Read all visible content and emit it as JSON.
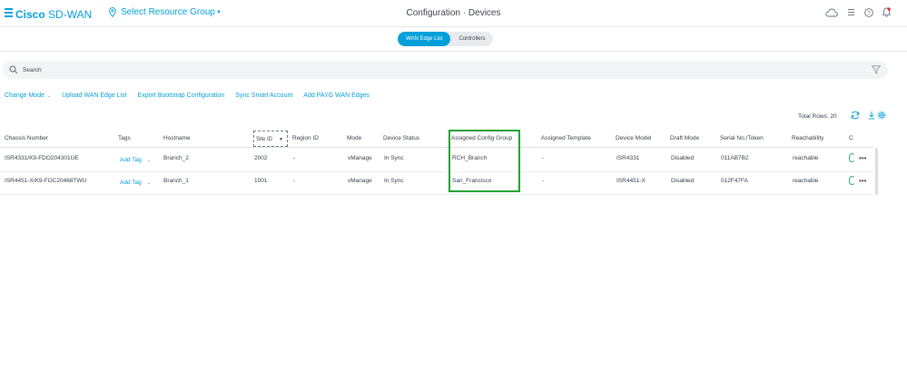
{
  "header": {
    "brand_bold": "Cisco",
    "brand_rest": "SD-WAN",
    "resource_group": "Select Resource Group",
    "title_left": "Configuration",
    "title_sep": "·",
    "title_right": "Devices"
  },
  "tabs": [
    {
      "label": "WAN Edge List",
      "active": true
    },
    {
      "label": "Controllers",
      "active": false
    }
  ],
  "search": {
    "placeholder": "Search"
  },
  "actions": {
    "change_mode": "Change Mode",
    "upload": "Upload WAN Edge List",
    "export": "Export Bootstrap Configuration",
    "sync": "Sync Smart Account",
    "add_payg": "Add PAYG WAN Edges"
  },
  "table": {
    "total_rows": "Total Rows: 20",
    "columns": {
      "chassis": "Chassis Number",
      "tags": "Tags",
      "hostname": "Hostname",
      "site_id": "Site ID",
      "region_id": "Region ID",
      "mode": "Mode",
      "device_status": "Device Status",
      "config_group": "Assigned Config Group",
      "template": "Assigned Template",
      "model": "Device Model",
      "draft": "Draft Mode",
      "serial": "Serial No./Token",
      "reachability": "Reachability",
      "c": "C"
    },
    "rows": [
      {
        "chassis": "ISR4331/K9-FDO204301UE",
        "tags": "Add Tag",
        "hostname": "Branch_2",
        "site_id": "2002",
        "region_id": "-",
        "mode": "vManage",
        "device_status": "In Sync",
        "config_group": "RCH_Branch",
        "template": "-",
        "model": "ISR4331",
        "draft": "Disabled",
        "serial": "011AB7B2",
        "reachability": "reachable"
      },
      {
        "chassis": "ISR4451-X/K9-FOC20468TWU",
        "tags": "Add Tag",
        "hostname": "Branch_1",
        "site_id": "1001",
        "region_id": "-",
        "mode": "vManage",
        "device_status": "In Sync",
        "config_group": "San_Francisco",
        "template": "-",
        "model": "ISR4451-X",
        "draft": "Disabled",
        "serial": "012F47FA",
        "reachability": "reachable"
      }
    ]
  },
  "colors": {
    "accent": "#049fd9",
    "highlight": "#23a035",
    "status_ok": "#2ea87e"
  },
  "icons": [
    "hamburger-icon",
    "location-pin-icon",
    "cloud-icon",
    "list-icon",
    "help-icon",
    "bell-icon",
    "search-icon",
    "filter-icon",
    "refresh-icon",
    "download-icon",
    "gear-icon",
    "more-icon"
  ]
}
